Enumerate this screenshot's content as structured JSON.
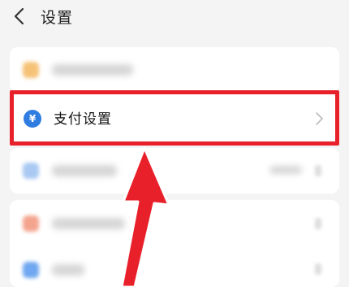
{
  "header": {
    "back_icon": "chevron-left-icon",
    "title": "设置"
  },
  "highlighted_row": {
    "icon": "yuan-coin-icon",
    "icon_glyph": "¥",
    "icon_color": "#2f7de1",
    "label": "支付设置",
    "chevron_icon": "chevron-right-icon"
  },
  "annotation": {
    "box_color": "#e8202a",
    "arrow_color": "#e8202a"
  }
}
